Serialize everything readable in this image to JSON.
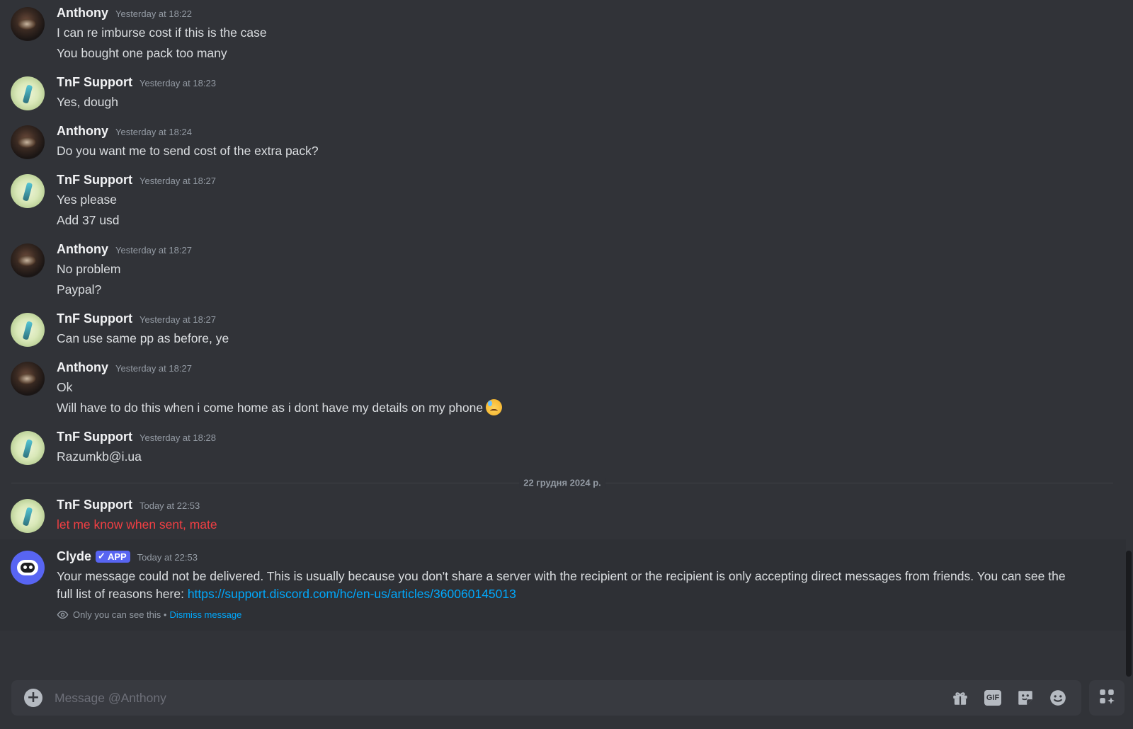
{
  "messages": [
    {
      "user": "Anthony",
      "avatar": "anthony",
      "time": "Yesterday at 18:22",
      "lines": [
        "I can re imburse cost if this is the case",
        "You bought one pack too many"
      ]
    },
    {
      "user": "TnF Support",
      "avatar": "tnf",
      "time": "Yesterday at 18:23",
      "lines": [
        "Yes, dough"
      ]
    },
    {
      "user": "Anthony",
      "avatar": "anthony",
      "time": "Yesterday at 18:24",
      "lines": [
        "Do you want me to send cost of the extra pack?"
      ]
    },
    {
      "user": "TnF Support",
      "avatar": "tnf",
      "time": "Yesterday at 18:27",
      "lines": [
        "Yes please",
        "Add 37 usd"
      ]
    },
    {
      "user": "Anthony",
      "avatar": "anthony",
      "time": "Yesterday at 18:27",
      "lines": [
        "No problem",
        "Paypal?"
      ]
    },
    {
      "user": "TnF Support",
      "avatar": "tnf",
      "time": "Yesterday at 18:27",
      "lines": [
        "Can use same pp as before, ye"
      ]
    },
    {
      "user": "Anthony",
      "avatar": "anthony",
      "time": "Yesterday at 18:27",
      "lines": [
        "Ok",
        "Will have to do this when i come home as i dont have my details on my phone"
      ],
      "emoji": "downcast-sweat-emoji"
    },
    {
      "user": "TnF Support",
      "avatar": "tnf",
      "time": "Yesterday at 18:28",
      "lines": [
        "Razumkb@i.ua"
      ]
    }
  ],
  "date_divider": "22 грудня 2024 р.",
  "failed_message": {
    "user": "TnF Support",
    "time": "Today at 22:53",
    "text": "let me know when sent, mate",
    "color": "#f23f43"
  },
  "clyde": {
    "user": "Clyde",
    "badge": "APP",
    "time": "Today at 22:53",
    "text": "Your message could not be delivered. This is usually because you don't share a server with the recipient or the recipient is only accepting direct messages from friends. You can see the full list of reasons here:",
    "link": "https://support.discord.com/hc/en-us/articles/360060145013",
    "ephemeral_note": "Only you can see this •",
    "dismiss": "Dismiss message"
  },
  "composer": {
    "placeholder": "Message @Anthony",
    "icons": [
      "add-attachment-icon",
      "gift-icon",
      "gif-icon",
      "sticker-icon",
      "emoji-icon",
      "apps-icon"
    ]
  },
  "colors": {
    "background": "#313338",
    "accent": "#5865f2",
    "link": "#00a8fc",
    "error": "#f23f43"
  }
}
